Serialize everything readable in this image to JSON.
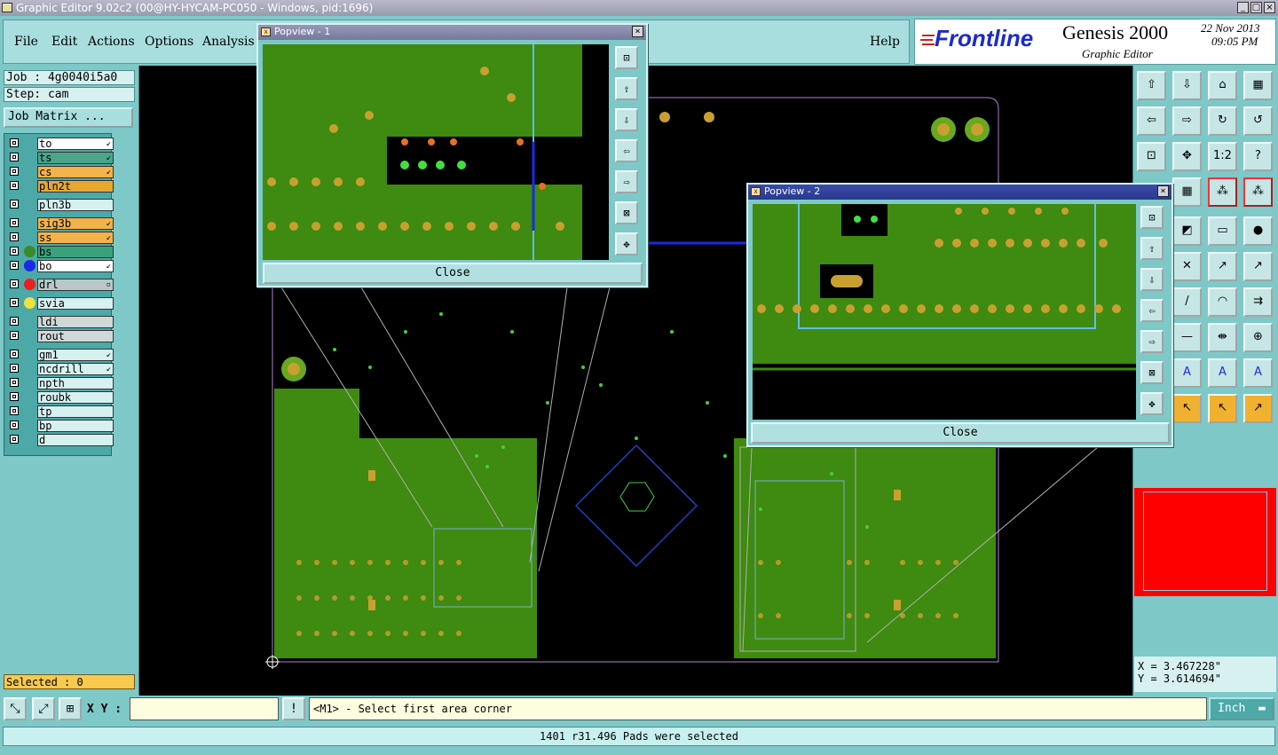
{
  "window": {
    "title": "Graphic Editor 9.02c2 (00@HY-HYCAM-PC050 - Windows, pid:1696)",
    "minimize": "_",
    "maximize": "□",
    "close": "×"
  },
  "menu": {
    "file": "File",
    "edit": "Edit",
    "actions": "Actions",
    "options": "Options",
    "analysis": "Analysis",
    "help": "Help"
  },
  "brand": {
    "logo": "Frontline",
    "product": "Genesis 2000",
    "subtitle": "Graphic Editor",
    "date": "22 Nov 2013",
    "time": "09:05 PM"
  },
  "job": {
    "job_line": "Job : 4g0040i5a0",
    "step_line": "Step: cam",
    "matrix_button": "Job Matrix ..."
  },
  "layers": [
    {
      "name": "to",
      "color": "#ffffff",
      "flag": "↙",
      "dot": ""
    },
    {
      "name": "ts",
      "color": "#4aa58a",
      "flag": "↙",
      "dot": ""
    },
    {
      "name": "cs",
      "color": "#f3b24a",
      "flag": "↙",
      "dot": ""
    },
    {
      "name": "pln2t",
      "color": "#e8a830",
      "flag": "",
      "dot": ""
    },
    {
      "name": "pln3b",
      "color": "#d7f0f0",
      "flag": "",
      "dot": ""
    },
    {
      "name": "sig3b",
      "color": "#f3b24a",
      "flag": "↙",
      "dot": ""
    },
    {
      "name": "ss",
      "color": "#f3b24a",
      "flag": "↙",
      "dot": ""
    },
    {
      "name": "bs",
      "color": "#3aa27a",
      "flag": "",
      "dot": "#3a8a2a"
    },
    {
      "name": "bo",
      "color": "#ffffff",
      "flag": "↙",
      "dot": "#1a2ae8"
    },
    {
      "name": "drl",
      "color": "#b8c8c8",
      "flag": "▫",
      "dot": "#e82020"
    },
    {
      "name": "svia",
      "color": "#d7f0f0",
      "flag": "",
      "dot": "#f0e040"
    },
    {
      "name": "ldi",
      "color": "#d0d8d8",
      "flag": "",
      "dot": ""
    },
    {
      "name": "rout",
      "color": "#d0d8d8",
      "flag": "",
      "dot": ""
    },
    {
      "name": "gm1",
      "color": "#d7f0f0",
      "flag": "↙",
      "dot": ""
    },
    {
      "name": "ncdrill",
      "color": "#d7f0f0",
      "flag": "↙",
      "dot": ""
    },
    {
      "name": "npth",
      "color": "#d7f0f0",
      "flag": "",
      "dot": ""
    },
    {
      "name": "roubk",
      "color": "#d7f0f0",
      "flag": "",
      "dot": ""
    },
    {
      "name": "tp",
      "color": "#d7f0f0",
      "flag": "",
      "dot": ""
    },
    {
      "name": "bp",
      "color": "#d7f0f0",
      "flag": "",
      "dot": ""
    },
    {
      "name": "d",
      "color": "#d7f0f0",
      "flag": "",
      "dot": ""
    }
  ],
  "selected": "Selected : 0",
  "popview1": {
    "title": "Popview - 1",
    "close_label": "Close"
  },
  "popview2": {
    "title": "Popview - 2",
    "close_label": "Close"
  },
  "toolbar": {
    "row1": [
      "⇧",
      "⇩",
      "⌂",
      "▦"
    ],
    "row2": [
      "⇦",
      "⇨",
      "↻",
      "↺"
    ],
    "row3": [
      "⊡",
      "✥",
      "1:2",
      "?"
    ],
    "row4": [
      "▦",
      "⁂",
      "⁂"
    ],
    "row5": [
      "◩",
      "▭",
      "●"
    ],
    "row6": [
      "✕",
      "↗",
      "↗"
    ],
    "row7": [
      "/",
      "◠",
      "⇉"
    ],
    "row8": [
      "—",
      "⇼",
      "⊕"
    ],
    "row9": [
      "A",
      "A",
      "A"
    ],
    "row10": [
      "↖",
      "↖",
      "↗"
    ],
    "accent_red": "#ff0000"
  },
  "coords": {
    "x": "X = 3.467228\"",
    "y": "Y = 3.614694\""
  },
  "bottom": {
    "xy_label": "X Y :",
    "xy_value": "",
    "prompt": "<M1> - Select first area corner",
    "unit": "Inch",
    "status": "1401 r31.496 Pads were selected",
    "alert": "!"
  }
}
